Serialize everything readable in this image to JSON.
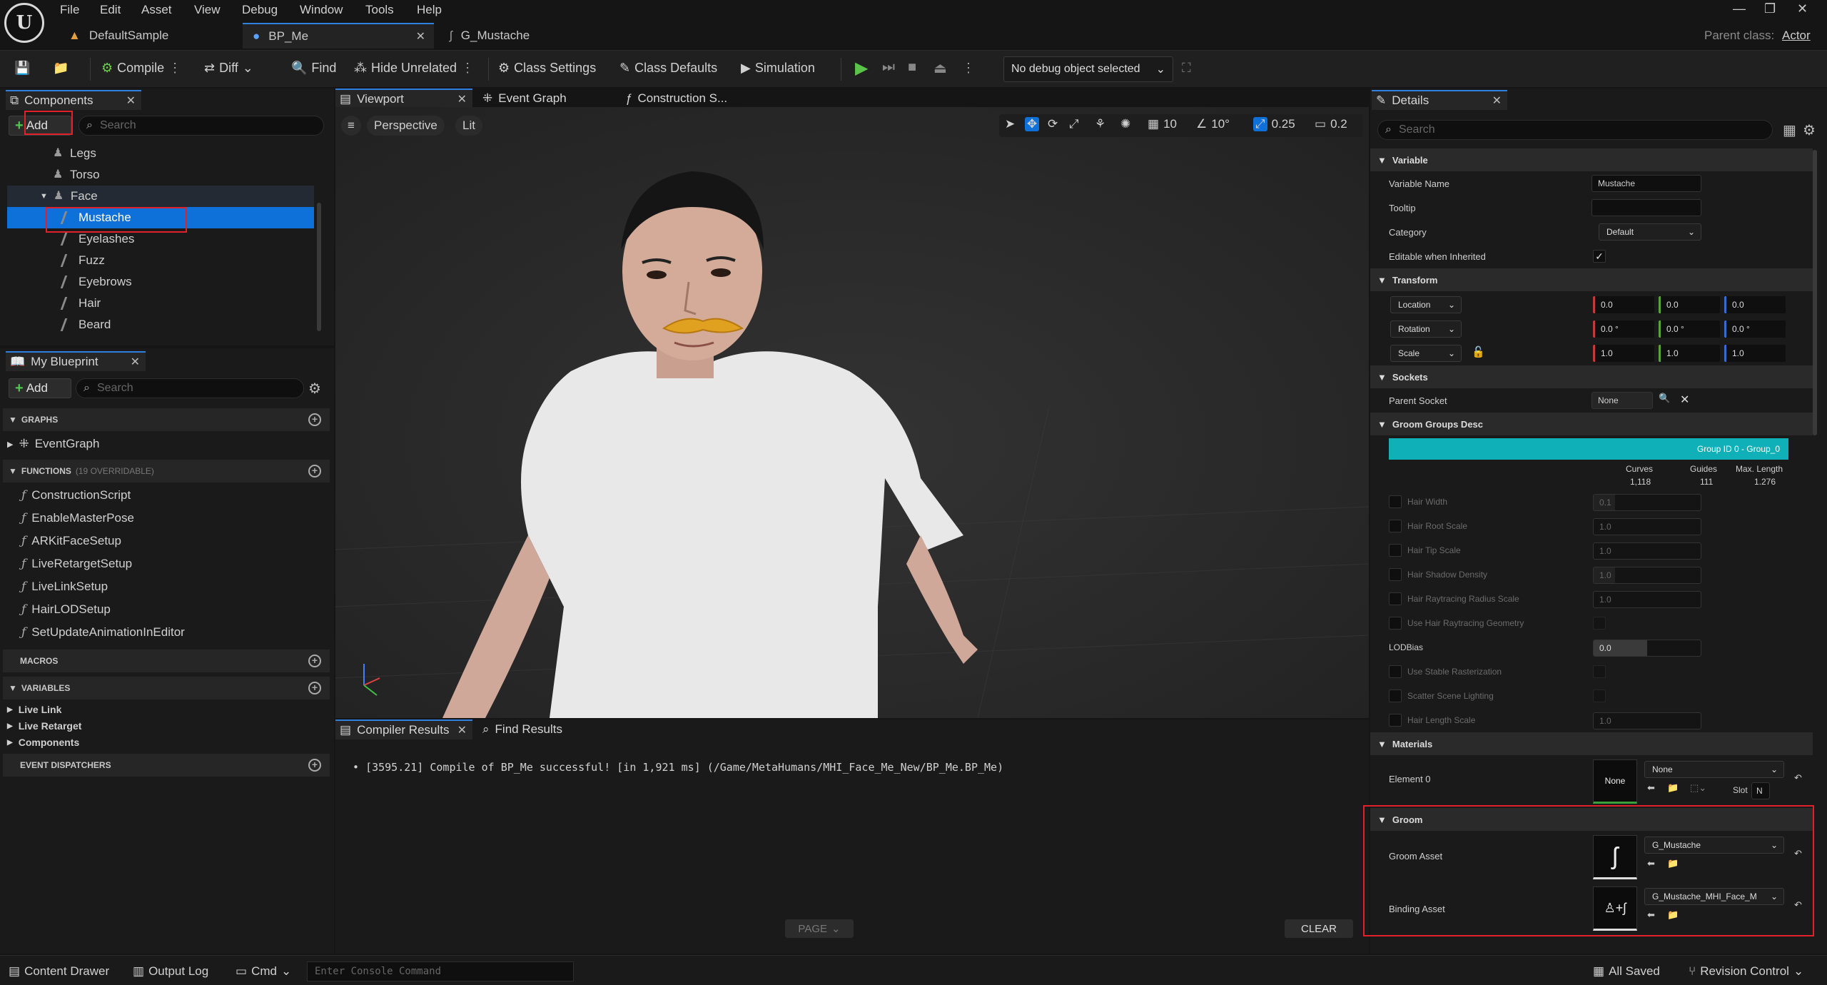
{
  "menu": [
    "File",
    "Edit",
    "Asset",
    "View",
    "Debug",
    "Window",
    "Tools",
    "Help"
  ],
  "doc_tabs": [
    {
      "label": "DefaultSample",
      "icon": "level-icon"
    },
    {
      "label": "BP_Me",
      "icon": "blueprint-icon"
    },
    {
      "label": "G_Mustache",
      "icon": "groom-icon"
    }
  ],
  "window": {
    "parent_class_label": "Parent class:",
    "parent_class_value": "Actor"
  },
  "toolbar": {
    "compile": "Compile",
    "diff": "Diff",
    "find": "Find",
    "hide_unrelated": "Hide Unrelated",
    "class_settings": "Class Settings",
    "class_defaults": "Class Defaults",
    "simulation": "Simulation",
    "debug_object": "No debug object selected"
  },
  "components_panel": {
    "title": "Components",
    "add": "Add",
    "search_placeholder": "Search",
    "items": [
      {
        "label": "Legs",
        "icon": "skeletal-mesh-icon",
        "indent": 1
      },
      {
        "label": "Torso",
        "icon": "skeletal-mesh-icon",
        "indent": 1
      },
      {
        "label": "Face",
        "icon": "skeletal-mesh-icon",
        "indent": 1
      },
      {
        "label": "Mustache",
        "icon": "groom-icon",
        "indent": 2
      },
      {
        "label": "Eyelashes",
        "icon": "groom-icon",
        "indent": 2
      },
      {
        "label": "Fuzz",
        "icon": "groom-icon",
        "indent": 2
      },
      {
        "label": "Eyebrows",
        "icon": "groom-icon",
        "indent": 2
      },
      {
        "label": "Hair",
        "icon": "groom-icon",
        "indent": 2
      },
      {
        "label": "Beard",
        "icon": "groom-icon",
        "indent": 2
      }
    ]
  },
  "my_blueprint": {
    "title": "My Blueprint",
    "add": "Add",
    "search_placeholder": "Search",
    "graphs_label": "GRAPHS",
    "event_graph": "EventGraph",
    "functions_label": "FUNCTIONS",
    "functions_count": "(19 OVERRIDABLE)",
    "functions": [
      "ConstructionScript",
      "EnableMasterPose",
      "ARKitFaceSetup",
      "LiveRetargetSetup",
      "LiveLinkSetup",
      "HairLODSetup",
      "SetUpdateAnimationInEditor"
    ],
    "macros_label": "MACROS",
    "variables_label": "VARIABLES",
    "variable_groups": [
      "Live Link",
      "Live Retarget",
      "Components"
    ],
    "dispatchers_label": "EVENT DISPATCHERS"
  },
  "center_tabs": {
    "viewport": "Viewport",
    "event_graph": "Event Graph",
    "construction": "Construction S..."
  },
  "viewport": {
    "perspective": "Perspective",
    "lit": "Lit",
    "grid": "10",
    "rot": "10°",
    "scale": "0.25",
    "cam": "0.2"
  },
  "compiler": {
    "tab1": "Compiler Results",
    "tab2": "Find Results",
    "message": "[3595.21] Compile of BP_Me successful! [in 1,921 ms] (/Game/MetaHumans/MHI_Face_Me_New/BP_Me.BP_Me)",
    "page": "PAGE",
    "clear": "CLEAR"
  },
  "details": {
    "title": "Details",
    "search_placeholder": "Search",
    "variable": {
      "header": "Variable",
      "name_label": "Variable Name",
      "name_value": "Mustache",
      "tooltip_label": "Tooltip",
      "category_label": "Category",
      "category_value": "Default",
      "editable_label": "Editable when Inherited"
    },
    "transform": {
      "header": "Transform",
      "location": "Location",
      "rotation": "Rotation",
      "scale": "Scale",
      "loc": [
        "0.0",
        "0.0",
        "0.0"
      ],
      "rot": [
        "0.0 °",
        "0.0 °",
        "0.0 °"
      ],
      "scl": [
        "1.0",
        "1.0",
        "1.0"
      ]
    },
    "sockets": {
      "header": "Sockets",
      "parent_label": "Parent Socket",
      "parent_value": "None"
    },
    "groom_groups": {
      "header": "Groom Groups Desc",
      "group": "Group ID 0 - Group_0",
      "curves_label": "Curves",
      "curves": "1,118",
      "guides_label": "Guides",
      "guides": "111",
      "maxlen_label": "Max. Length",
      "maxlen": "1.276",
      "props": [
        {
          "label": "Hair Width",
          "value": "0.1",
          "bar": 0.2
        },
        {
          "label": "Hair Root Scale",
          "value": "1.0",
          "bar": 0
        },
        {
          "label": "Hair Tip Scale",
          "value": "1.0",
          "bar": 0
        },
        {
          "label": "Hair Shadow Density",
          "value": "1.0",
          "bar": 0.2
        },
        {
          "label": "Hair Raytracing Radius Scale",
          "value": "1.0",
          "bar": 0
        },
        {
          "label": "Use Hair Raytracing Geometry",
          "value": "",
          "bar": -1
        },
        {
          "label": "LODBias",
          "value": "0.0",
          "bar": 0.5,
          "bright": true
        },
        {
          "label": "Use Stable Rasterization",
          "value": "",
          "bar": -1
        },
        {
          "label": "Scatter Scene Lighting",
          "value": "",
          "bar": -1
        },
        {
          "label": "Hair Length Scale",
          "value": "1.0",
          "bar": 0
        }
      ]
    },
    "materials": {
      "header": "Materials",
      "element_label": "Element 0",
      "thumb": "None",
      "value": "None",
      "slot_label": "Slot",
      "slot_value": "N"
    },
    "groom": {
      "header": "Groom",
      "asset_label": "Groom Asset",
      "asset_value": "G_Mustache",
      "binding_label": "Binding Asset",
      "binding_value": "G_Mustache_MHI_Face_M"
    }
  },
  "statusbar": {
    "content_drawer": "Content Drawer",
    "output_log": "Output Log",
    "cmd": "Cmd",
    "console_placeholder": "Enter Console Command",
    "all_saved": "All Saved",
    "revision": "Revision Control"
  }
}
